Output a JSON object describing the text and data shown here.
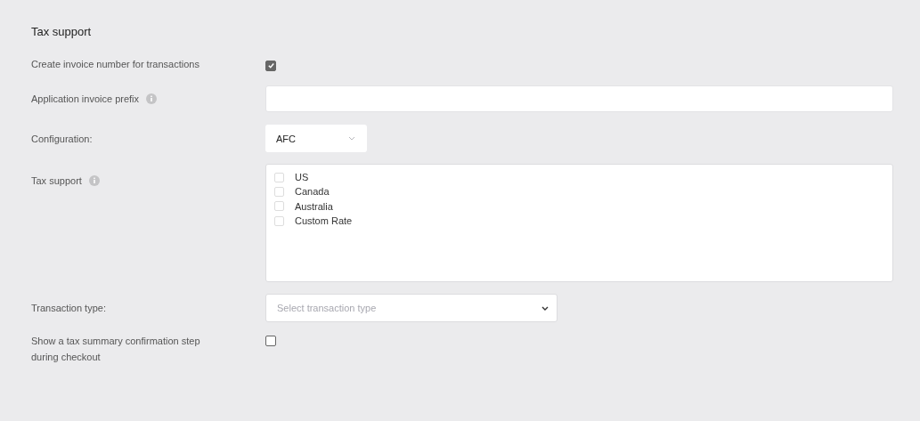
{
  "section_title": "Tax support",
  "fields": [
    {
      "kind": "checkbox",
      "label": "Create invoice number for transactions",
      "checked": true
    },
    {
      "kind": "text",
      "label": "Application invoice prefix",
      "info": true
    },
    {
      "kind": "select",
      "label": "Configuration:",
      "value": "AFC"
    },
    {
      "kind": "checklist",
      "label": "Tax support",
      "info": true,
      "options": [
        {
          "label": "US",
          "checked": false
        },
        {
          "label": "Canada",
          "checked": false
        },
        {
          "label": "Australia",
          "checked": false
        },
        {
          "label": "Custom Rate",
          "checked": false
        }
      ]
    },
    {
      "kind": "dropdown",
      "label": "Transaction type:",
      "placeholder": "Select transaction type"
    },
    {
      "kind": "checkbox",
      "label": "Show a tax summary confirmation step during checkout",
      "checked": false
    }
  ]
}
